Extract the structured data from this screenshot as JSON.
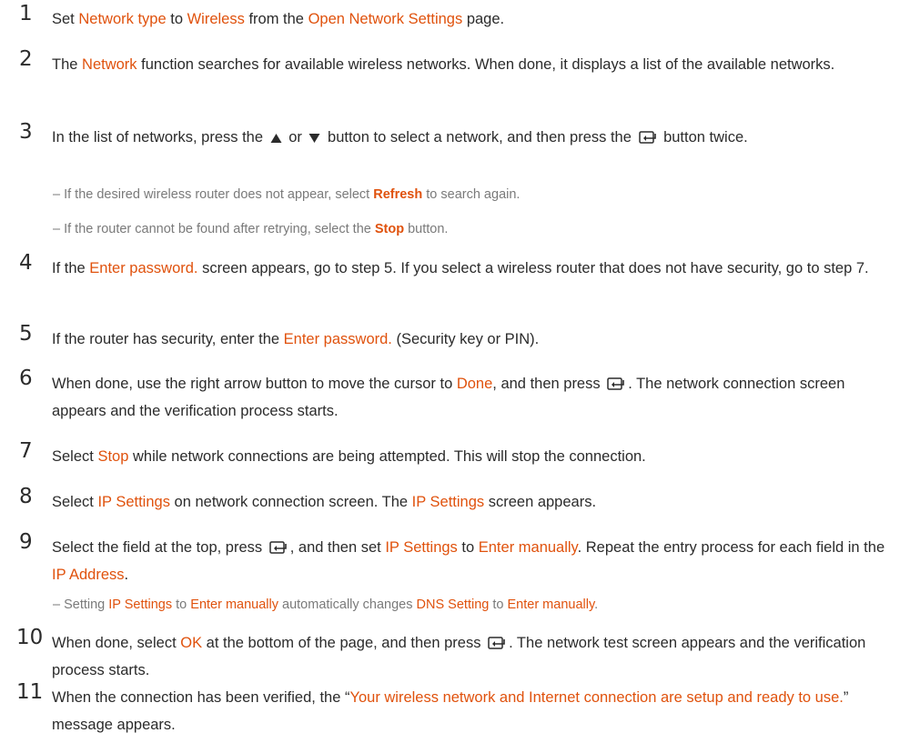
{
  "steps": [
    {
      "num": "1",
      "parts": [
        "Set ",
        "Network type",
        " to ",
        "Wireless",
        " from the ",
        "Open Network Settings",
        " page."
      ]
    },
    {
      "num": "2",
      "parts": [
        "The ",
        "Network",
        " function searches for available wireless networks. When done, it displays a list of the available networks."
      ]
    },
    {
      "num": "3",
      "parts": [
        "In the list of networks, press the ",
        " or ",
        " button to select a network, and then press the ",
        " button twice."
      ]
    },
    {
      "num": "4",
      "parts": [
        "If the ",
        "Enter password.",
        " screen appears, go to step 5. If you select a wireless router that does not have security, go to step 7."
      ]
    },
    {
      "num": "5",
      "parts": [
        "If the router has security, enter the ",
        "Enter password.",
        " (Security key or PIN)."
      ]
    },
    {
      "num": "6",
      "parts": [
        "When done, use the right arrow button to move the cursor to ",
        "Done",
        ", and then press ",
        ". The network connection screen appears and the verification process starts."
      ]
    },
    {
      "num": "7",
      "parts": [
        "Select ",
        "Stop",
        " while network connections are being attempted. This will stop the connection."
      ]
    },
    {
      "num": "8",
      "parts": [
        "Select ",
        "IP Settings",
        " on network connection screen. The ",
        "IP Settings",
        " screen appears."
      ]
    },
    {
      "num": "9",
      "parts": [
        "Select the field at the top, press ",
        ", and then set ",
        "IP Settings",
        " to ",
        "Enter manually",
        ". Repeat the entry process for each field in the ",
        "IP Address",
        "."
      ]
    },
    {
      "num": "10",
      "parts": [
        "When done, select ",
        "OK",
        " at the bottom of the page, and then press ",
        ". The network test screen appears and the verification process starts."
      ]
    },
    {
      "num": "11",
      "parts": [
        "When the connection has been verified, the “",
        "Your wireless network and Internet connection are setup and ready to use.",
        "” message appears."
      ]
    }
  ],
  "notes": [
    {
      "parts": [
        "– If the desired wireless router does not appear, select ",
        "Refresh",
        " to search again."
      ]
    },
    {
      "parts": [
        "– If the router cannot be found after retrying, select the ",
        "Stop",
        " button."
      ]
    },
    {
      "parts": [
        "– Setting ",
        "IP Settings",
        " to ",
        "Enter manually",
        " automatically changes ",
        "DNS Setting",
        " to ",
        "Enter manually",
        "."
      ]
    }
  ],
  "colors": {
    "highlight": "#e0520d",
    "text": "#2b2b2b",
    "note": "#7a7a7a"
  },
  "icons": [
    "up-arrow-icon",
    "down-arrow-icon",
    "enter-icon"
  ]
}
